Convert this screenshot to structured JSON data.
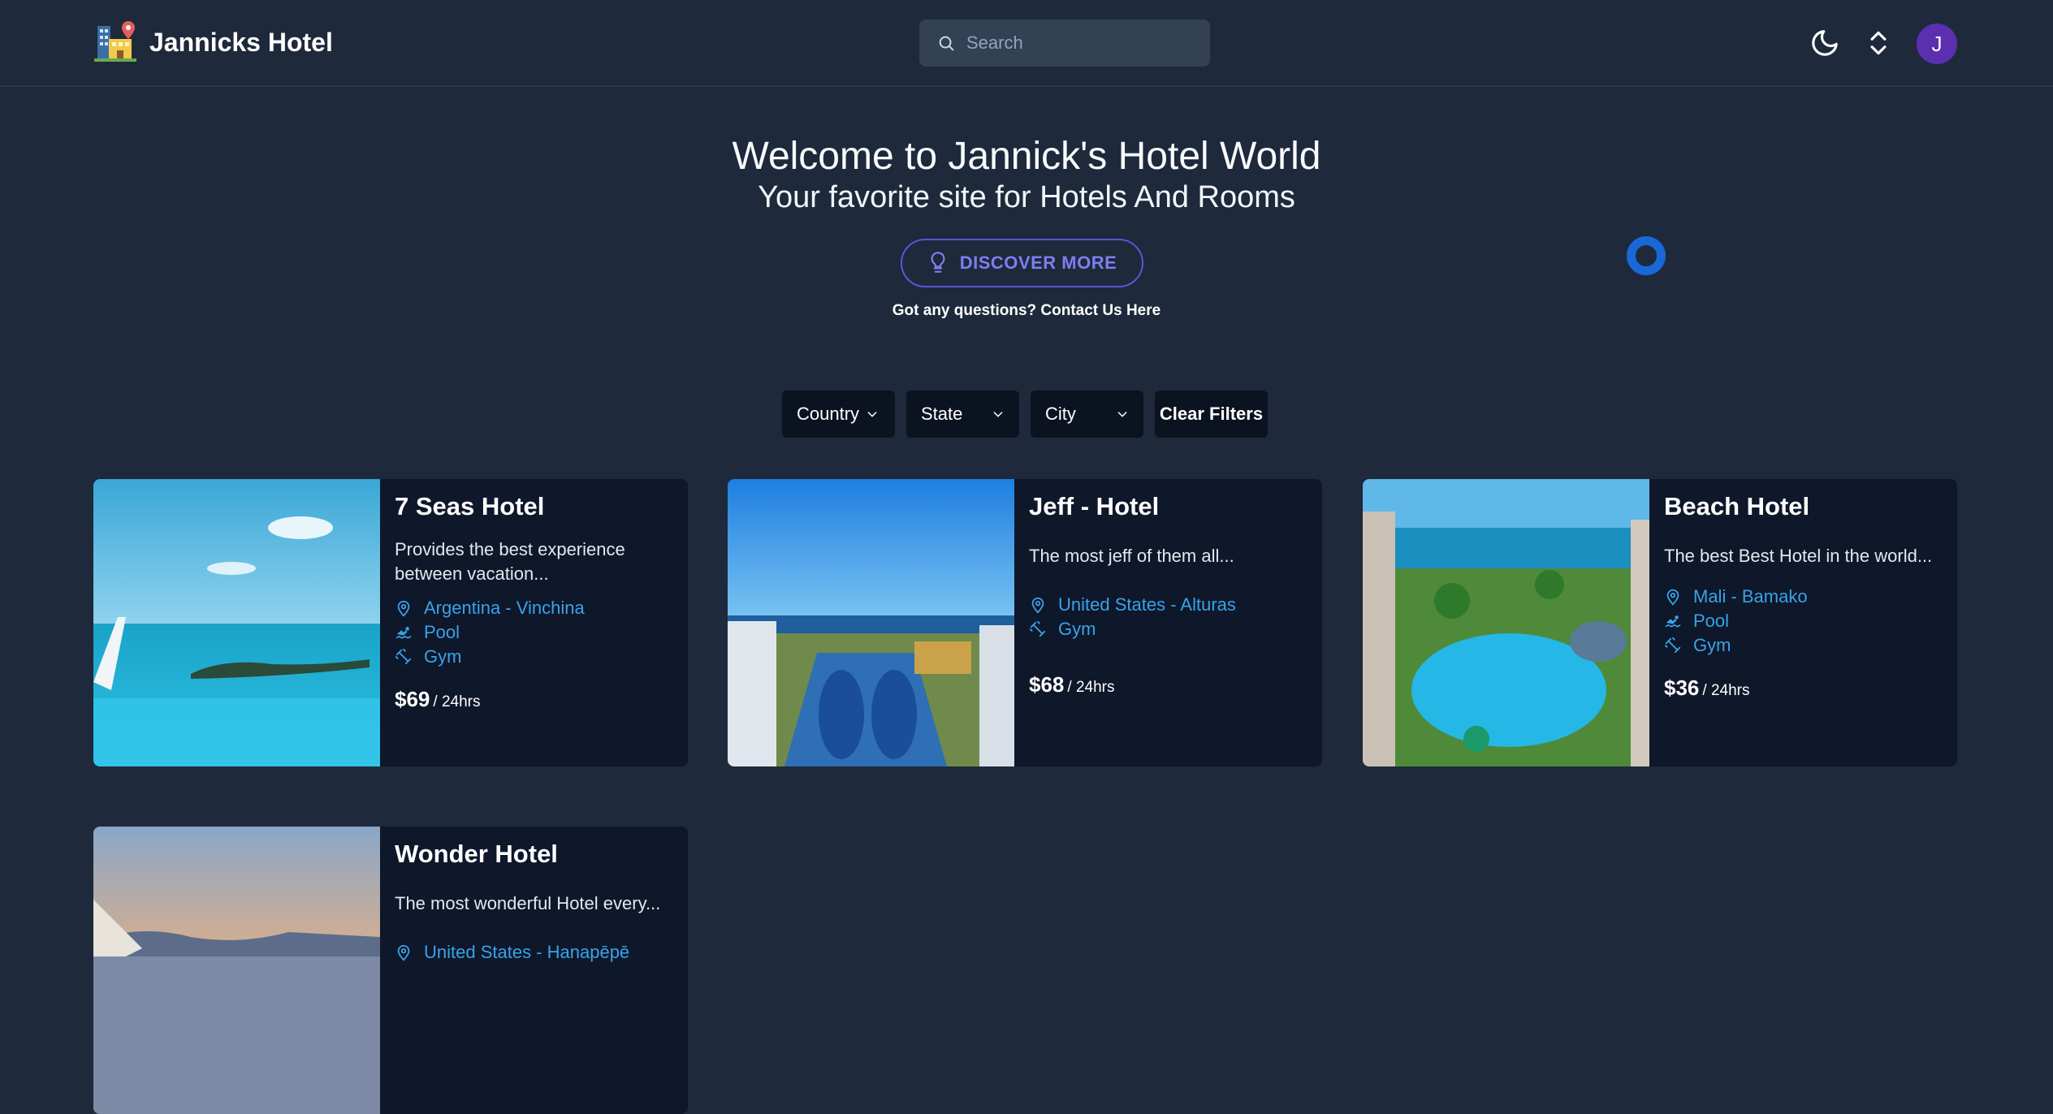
{
  "header": {
    "brand": "Jannicks Hotel",
    "search_placeholder": "Search",
    "avatar_initial": "J"
  },
  "hero": {
    "title": "Welcome to Jannick's Hotel World",
    "subtitle": "Your favorite site for Hotels And Rooms",
    "discover_label": "DISCOVER MORE",
    "contact_text": "Got any questions? Contact Us Here"
  },
  "filters": {
    "country": "Country",
    "state": "State",
    "city": "City",
    "clear": "Clear Filters"
  },
  "hotels": [
    {
      "name": "7 Seas Hotel",
      "description": "Provides the best experience between vacation...",
      "location": "Argentina - Vinchina",
      "amenities": [
        "Pool",
        "Gym"
      ],
      "price": "$69",
      "per": "/ 24hrs"
    },
    {
      "name": "Jeff - Hotel",
      "description": "The most jeff of them all...",
      "location": "United States - Alturas",
      "amenities": [
        "Gym"
      ],
      "price": "$68",
      "per": "/ 24hrs"
    },
    {
      "name": "Beach Hotel",
      "description": "The best Best Hotel in the world...",
      "location": "Mali - Bamako",
      "amenities": [
        "Pool",
        "Gym"
      ],
      "price": "$36",
      "per": "/ 24hrs"
    },
    {
      "name": "Wonder Hotel",
      "description": "The most wonderful Hotel every...",
      "location": "United States - Hanapēpē",
      "amenities": [],
      "price": "",
      "per": ""
    }
  ],
  "colors": {
    "background": "#1e293b",
    "card": "#0f172a",
    "accent": "#7c7ff0",
    "link": "#38a3e8"
  }
}
